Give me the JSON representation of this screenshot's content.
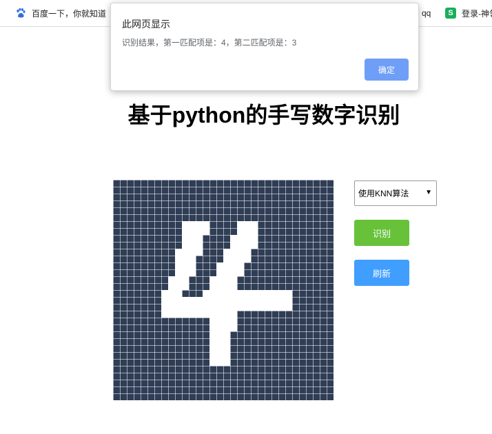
{
  "bookmarks": {
    "baidu_label": "百度一下，你就知道",
    "qq_label": "qq",
    "login_label": "登录-神领"
  },
  "dialog": {
    "title": "此网页显示",
    "message": "识别结果，第一匹配项是：4，第二匹配项是：3",
    "ok_label": "确定",
    "ok_color": "#6f9ef7"
  },
  "page": {
    "title": "基于python的手写数字识别"
  },
  "controls": {
    "algorithm_selected": "使用KNN算法",
    "recognize_label": "识别",
    "recognize_color": "#67c23a",
    "refresh_label": "刷新",
    "refresh_color": "#409eff"
  },
  "canvas": {
    "grid_cells": 32,
    "cell_color": "#2f3d55",
    "stroke_color": "#ffffff",
    "drawn_digit_cells": [
      [
        10,
        6
      ],
      [
        11,
        6
      ],
      [
        12,
        6
      ],
      [
        13,
        6
      ],
      [
        18,
        6
      ],
      [
        19,
        6
      ],
      [
        20,
        6
      ],
      [
        10,
        7
      ],
      [
        11,
        7
      ],
      [
        12,
        7
      ],
      [
        13,
        7
      ],
      [
        18,
        7
      ],
      [
        19,
        7
      ],
      [
        20,
        7
      ],
      [
        10,
        8
      ],
      [
        11,
        8
      ],
      [
        12,
        8
      ],
      [
        17,
        8
      ],
      [
        18,
        8
      ],
      [
        19,
        8
      ],
      [
        20,
        8
      ],
      [
        10,
        9
      ],
      [
        11,
        9
      ],
      [
        12,
        9
      ],
      [
        17,
        9
      ],
      [
        18,
        9
      ],
      [
        19,
        9
      ],
      [
        20,
        9
      ],
      [
        9,
        10
      ],
      [
        10,
        10
      ],
      [
        11,
        10
      ],
      [
        12,
        10
      ],
      [
        16,
        10
      ],
      [
        17,
        10
      ],
      [
        18,
        10
      ],
      [
        19,
        10
      ],
      [
        9,
        11
      ],
      [
        10,
        11
      ],
      [
        11,
        11
      ],
      [
        16,
        11
      ],
      [
        17,
        11
      ],
      [
        18,
        11
      ],
      [
        19,
        11
      ],
      [
        9,
        12
      ],
      [
        10,
        12
      ],
      [
        11,
        12
      ],
      [
        15,
        12
      ],
      [
        16,
        12
      ],
      [
        17,
        12
      ],
      [
        18,
        12
      ],
      [
        9,
        13
      ],
      [
        10,
        13
      ],
      [
        11,
        13
      ],
      [
        15,
        13
      ],
      [
        16,
        13
      ],
      [
        17,
        13
      ],
      [
        18,
        13
      ],
      [
        8,
        14
      ],
      [
        9,
        14
      ],
      [
        10,
        14
      ],
      [
        14,
        14
      ],
      [
        15,
        14
      ],
      [
        16,
        14
      ],
      [
        17,
        14
      ],
      [
        8,
        15
      ],
      [
        9,
        15
      ],
      [
        10,
        15
      ],
      [
        14,
        15
      ],
      [
        15,
        15
      ],
      [
        16,
        15
      ],
      [
        17,
        15
      ],
      [
        7,
        16
      ],
      [
        8,
        16
      ],
      [
        9,
        16
      ],
      [
        13,
        16
      ],
      [
        14,
        16
      ],
      [
        15,
        16
      ],
      [
        16,
        16
      ],
      [
        17,
        16
      ],
      [
        18,
        16
      ],
      [
        19,
        16
      ],
      [
        20,
        16
      ],
      [
        21,
        16
      ],
      [
        22,
        16
      ],
      [
        23,
        16
      ],
      [
        24,
        16
      ],
      [
        25,
        16
      ],
      [
        7,
        17
      ],
      [
        8,
        17
      ],
      [
        9,
        17
      ],
      [
        10,
        17
      ],
      [
        11,
        17
      ],
      [
        12,
        17
      ],
      [
        13,
        17
      ],
      [
        14,
        17
      ],
      [
        15,
        17
      ],
      [
        16,
        17
      ],
      [
        17,
        17
      ],
      [
        18,
        17
      ],
      [
        19,
        17
      ],
      [
        20,
        17
      ],
      [
        21,
        17
      ],
      [
        22,
        17
      ],
      [
        23,
        17
      ],
      [
        24,
        17
      ],
      [
        25,
        17
      ],
      [
        7,
        18
      ],
      [
        8,
        18
      ],
      [
        9,
        18
      ],
      [
        10,
        18
      ],
      [
        11,
        18
      ],
      [
        12,
        18
      ],
      [
        13,
        18
      ],
      [
        14,
        18
      ],
      [
        15,
        18
      ],
      [
        16,
        18
      ],
      [
        17,
        18
      ],
      [
        18,
        18
      ],
      [
        19,
        18
      ],
      [
        20,
        18
      ],
      [
        21,
        18
      ],
      [
        22,
        18
      ],
      [
        23,
        18
      ],
      [
        24,
        18
      ],
      [
        25,
        18
      ],
      [
        7,
        19
      ],
      [
        8,
        19
      ],
      [
        9,
        19
      ],
      [
        10,
        19
      ],
      [
        11,
        19
      ],
      [
        12,
        19
      ],
      [
        13,
        19
      ],
      [
        14,
        19
      ],
      [
        15,
        19
      ],
      [
        16,
        19
      ],
      [
        17,
        19
      ],
      [
        14,
        20
      ],
      [
        15,
        20
      ],
      [
        16,
        20
      ],
      [
        17,
        20
      ],
      [
        14,
        21
      ],
      [
        15,
        21
      ],
      [
        16,
        21
      ],
      [
        17,
        21
      ],
      [
        14,
        22
      ],
      [
        15,
        22
      ],
      [
        16,
        22
      ],
      [
        14,
        23
      ],
      [
        15,
        23
      ],
      [
        16,
        23
      ],
      [
        14,
        24
      ],
      [
        15,
        24
      ],
      [
        16,
        24
      ],
      [
        14,
        25
      ],
      [
        15,
        25
      ],
      [
        16,
        25
      ],
      [
        14,
        26
      ],
      [
        15,
        26
      ],
      [
        16,
        26
      ]
    ]
  }
}
